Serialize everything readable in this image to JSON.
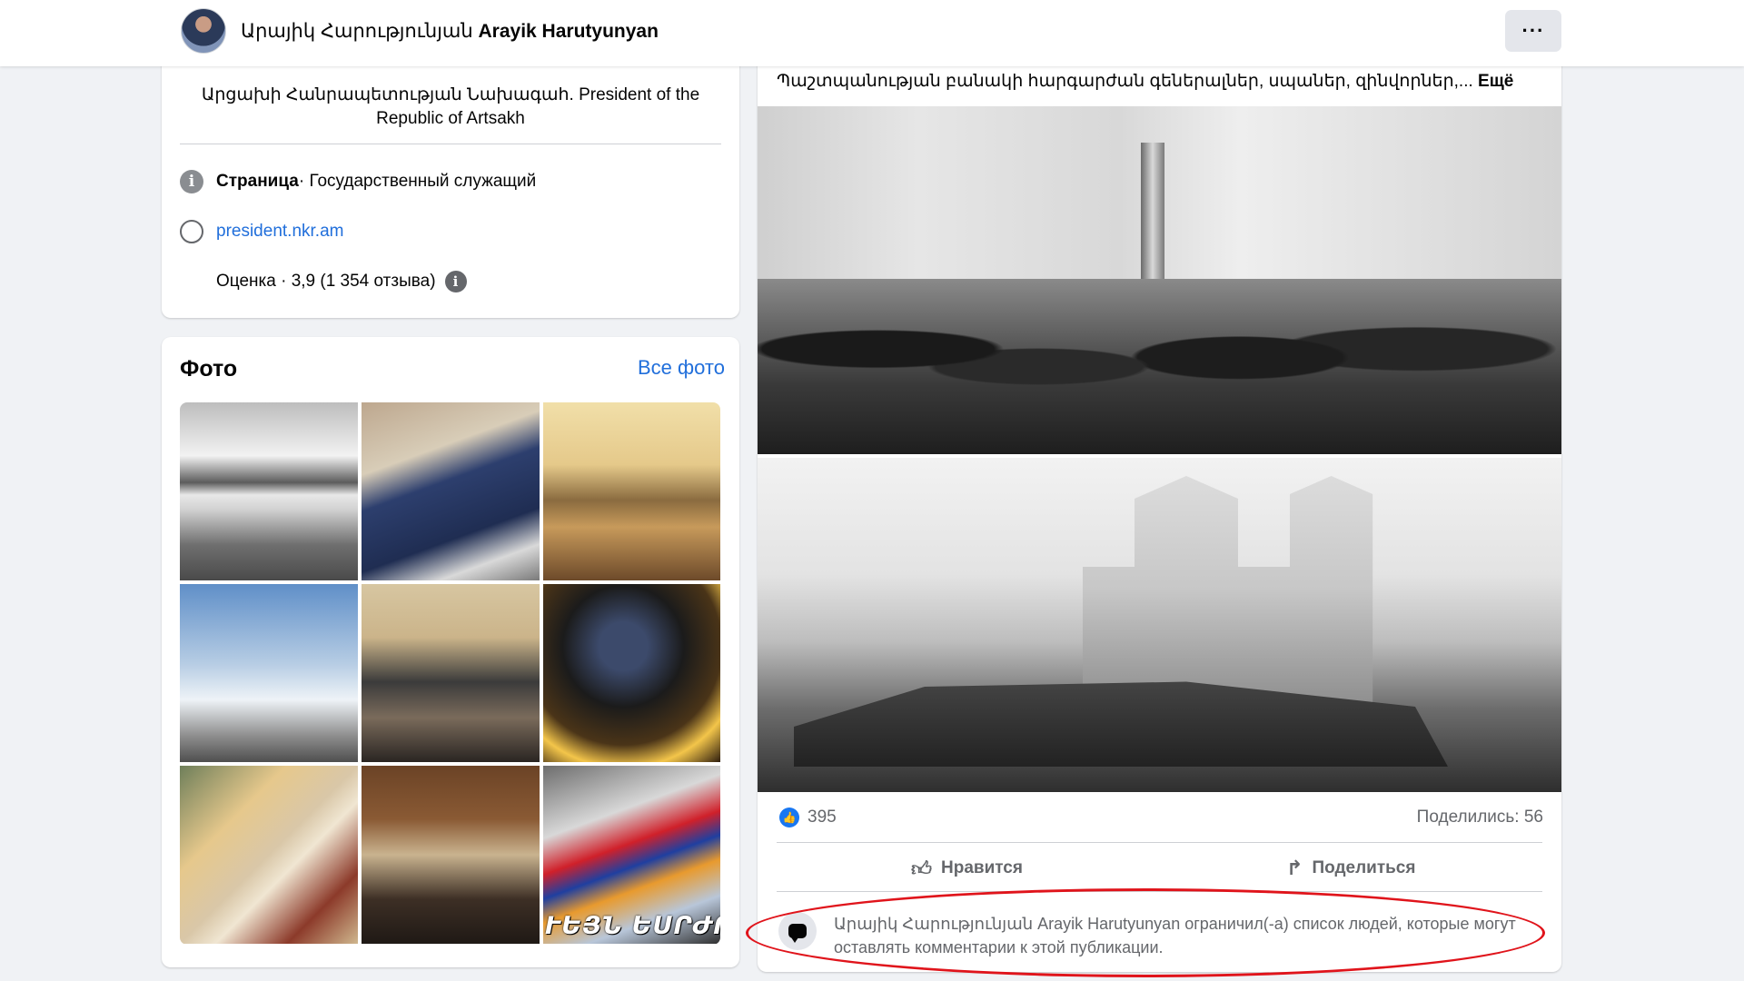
{
  "header": {
    "page_name_armenian": "Արայիկ Հարությունյան",
    "page_name_latin": "Arayik Harutyunyan",
    "more_label": "···"
  },
  "intro": {
    "description": "Արցախի Հանրապետության Նախագահ. President of the Republic of Artsakh",
    "category_label": "Страница",
    "category_value": " · Государственный служащий",
    "website": "president.nkr.am",
    "rating": "Оценка · 3,9 (1 354 отзыва)",
    "icons": {
      "info": "info-icon",
      "globe": "globe-icon",
      "star": "star-icon"
    }
  },
  "photos": {
    "title": "Фото",
    "see_all": "Все фото",
    "last_photo_caption": "ՒԵՅՆ ԵՍՐԺՈՒ"
  },
  "post": {
    "text": "Պաշտպանության բանակի հարգարժան գեներալներ, սպաներ, զինվորներ,...",
    "more_label": " Ещё",
    "like_count": "395",
    "shares": "Поделились: 56",
    "like_button": "Нравится",
    "share_button": "Поделиться",
    "comment_notice": "Արայիկ Հարությունյան Arayik Harutyunyan ограничил(-а) список людей, которые могут оставлять комментарии к этой публикации."
  },
  "colors": {
    "accent": "#1877f2",
    "link": "#216fdb",
    "highlight": "#e0141b",
    "background": "#f0f2f5"
  }
}
